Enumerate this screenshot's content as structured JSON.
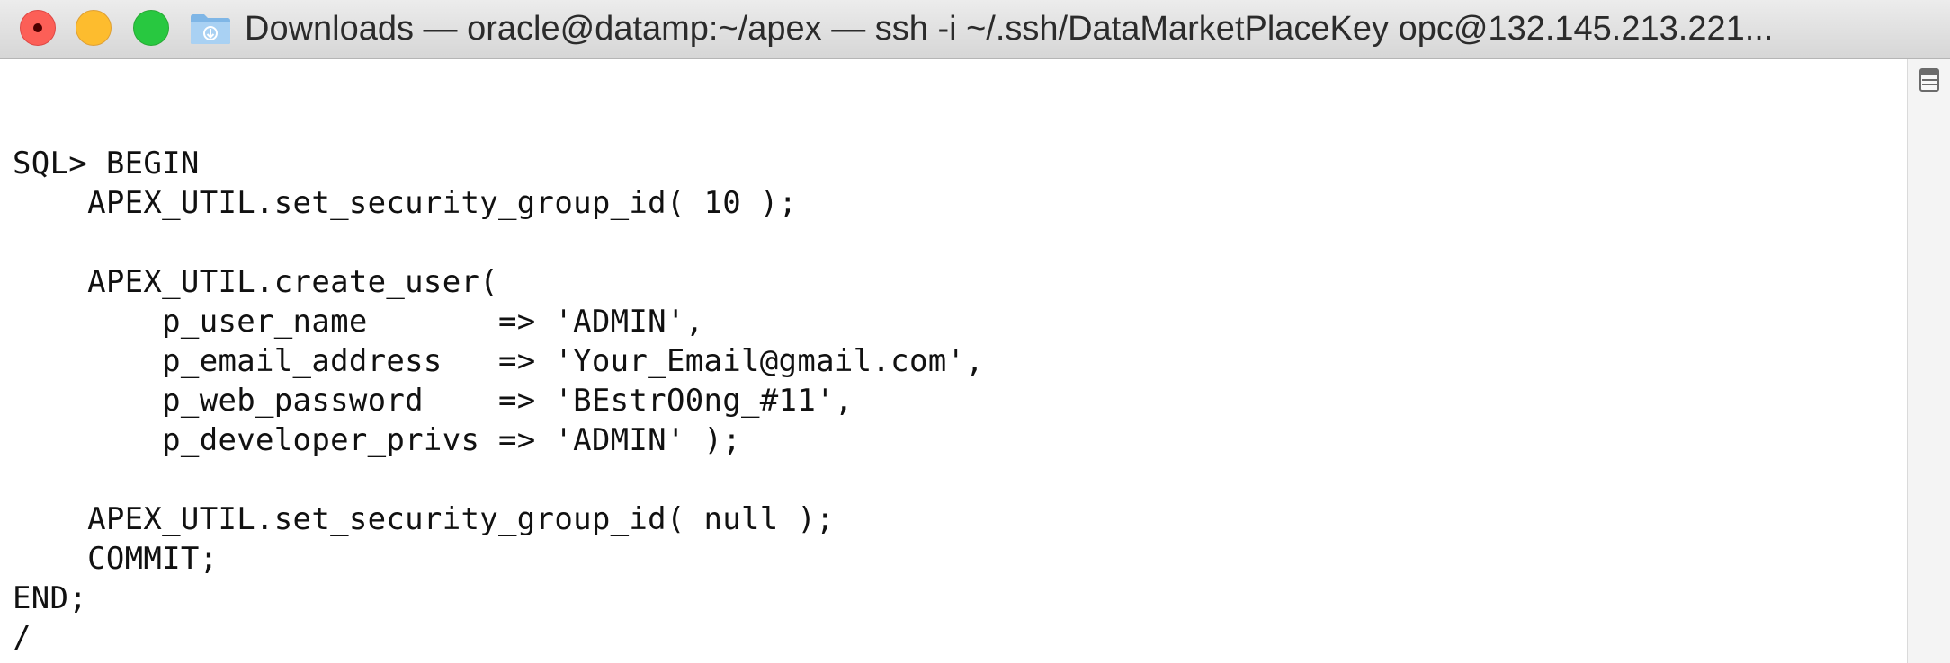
{
  "window": {
    "title": "Downloads — oracle@datamp:~/apex — ssh -i ~/.ssh/DataMarketPlaceKey opc@132.145.213.221...",
    "controls": [
      "close",
      "minimize",
      "zoom"
    ],
    "folder_icon": "folder-icon"
  },
  "terminal": {
    "lines": [
      "SQL> BEGIN",
      "    APEX_UTIL.set_security_group_id( 10 );",
      "",
      "    APEX_UTIL.create_user(",
      "        p_user_name       => 'ADMIN',",
      "        p_email_address   => 'Your_Email@gmail.com',",
      "        p_web_password    => 'BEstrO0ng_#11',",
      "        p_developer_privs => 'ADMIN' );",
      "",
      "    APEX_UTIL.set_security_group_id( null );",
      "    COMMIT;",
      "END;",
      "/"
    ]
  },
  "scrollbar": {
    "icon": "split-pane-icon"
  }
}
